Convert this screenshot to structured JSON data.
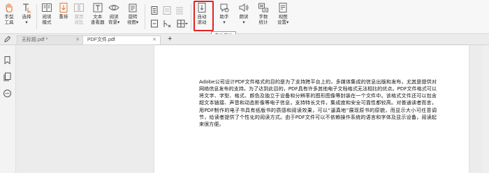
{
  "ribbon": {
    "items": [
      {
        "label": "手型\n工具"
      },
      {
        "label": "选择\n▾"
      },
      {
        "label": "阅读\n模式"
      },
      {
        "label": "重排"
      },
      {
        "label": "双页\n对比"
      },
      {
        "label": "文本\n查看器"
      },
      {
        "label": "阅读\n背景▾"
      },
      {
        "label": "旋转\n视图▾"
      },
      {
        "label": "自动\n滚动"
      },
      {
        "label": "助手\n▾"
      },
      {
        "label": "朗读\n▾"
      },
      {
        "label": "字数\n统计"
      },
      {
        "label": "视图\n设置▾"
      }
    ],
    "tooltip": "自动滚动",
    "highlight_color": "#e02222"
  },
  "tabs": [
    {
      "label": "无标题.pdf *",
      "close": "✕"
    },
    {
      "label": "PDF文件.pdf",
      "close": "✕"
    }
  ],
  "new_tab": "+",
  "document": {
    "paragraph": "Adobe公司设计PDF文件格式的目的是为了支持跨平台上的，多媒体集成的信息出版和发布，尤其是提供对网络信息发布的支持。为了达到此目的，PDF具有许多其他电子文档格式无法相比的优点。PDF文件格式可以将文字、字型、格式、颜色及独立于设备和分辨率的图形图像等封装在一个文件中。该格式文件还可以包含超文本链接、声音和动态影像等电子信息，支持特长文件，集成度和安全可靠性都较高。对普通读者而言，用PDF制作的电子书具有纸版书的质感和阅读效果，可以“逼真地”展现原书的原貌，而显示大小可任意调节，给读者提供了个性化的阅读方式。由于PDF文件可以不依赖操作系统的语言和字体及显示设备，阅读起来很方便。"
  }
}
